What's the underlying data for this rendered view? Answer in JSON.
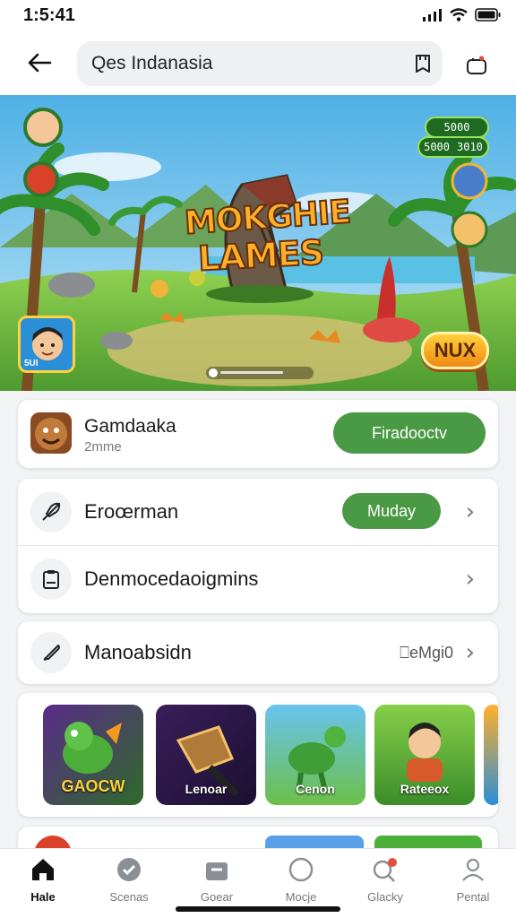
{
  "status_bar": {
    "time": "1:5:41"
  },
  "search": {
    "query": "Qes Indanasia"
  },
  "banner": {
    "title_line1": "MOKGHIE",
    "title_line2": "LAMES",
    "stat_top": "5000",
    "stat_mid_left": "5000",
    "stat_mid_right": "3010",
    "action_label": "NUX",
    "avatar_label": "5UI"
  },
  "app_card": {
    "name": "Gamdaaka",
    "subtitle": "2mme",
    "install_label": "Firadooctv"
  },
  "menu": {
    "rows": [
      {
        "label": "Eroœrman",
        "button_label": "Muday"
      },
      {
        "label": "Denmocedaoigmins"
      },
      {
        "label": "Manoabsidn",
        "value": "⎕eMgi0"
      }
    ]
  },
  "games": [
    {
      "title": "GAOCW"
    },
    {
      "title": "Lenoar"
    },
    {
      "title": "Cenon"
    },
    {
      "title": "Rateeox"
    }
  ],
  "bottom_nav": {
    "items": [
      {
        "label": "Hale"
      },
      {
        "label": "Scenas"
      },
      {
        "label": "Goear"
      },
      {
        "label": "Mocje"
      },
      {
        "label": "Glacky"
      },
      {
        "label": "Pental"
      }
    ]
  },
  "colors": {
    "accent_green": "#4a9a45",
    "sky": "#7fc6ee",
    "grass": "#6db543",
    "banner_gold": "#ffb02a"
  }
}
